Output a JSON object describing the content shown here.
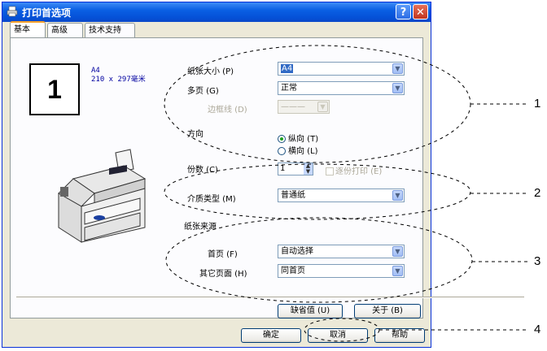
{
  "window": {
    "title": "打印首选项",
    "help_glyph": "?",
    "close_glyph": "✕"
  },
  "tabs": [
    {
      "label": "基本",
      "active": true
    },
    {
      "label": "高级",
      "active": false
    },
    {
      "label": "技术支持",
      "active": false
    }
  ],
  "preview": {
    "number": "1",
    "paper": "A4",
    "dims": "210 x 297毫米"
  },
  "fields": {
    "paper_size": {
      "label": "纸张大小 (P)",
      "value": "A4"
    },
    "multi_page": {
      "label": "多页 (G)",
      "value": "正常"
    },
    "border": {
      "label": "边框线 (D)",
      "value": "———"
    },
    "orientation": {
      "label": "方向",
      "portrait": "纵向 (T)",
      "landscape": "横向 (L)",
      "selected": "portrait"
    },
    "copies": {
      "label": "份数 (C)",
      "value": "1",
      "collate": "逐份打印 (E)"
    },
    "media": {
      "label": "介质类型 (M)",
      "value": "普通纸"
    },
    "source": {
      "title": "纸张来源",
      "first_label": "首页 (F)",
      "first_value": "自动选择",
      "other_label": "其它页面 (H)",
      "other_value": "同首页"
    }
  },
  "buttons": {
    "default": "缺省值 (U)",
    "about": "关于 (B)",
    "ok": "确定",
    "cancel": "取消",
    "help": "帮助"
  },
  "callouts": [
    "1",
    "2",
    "3",
    "4"
  ]
}
